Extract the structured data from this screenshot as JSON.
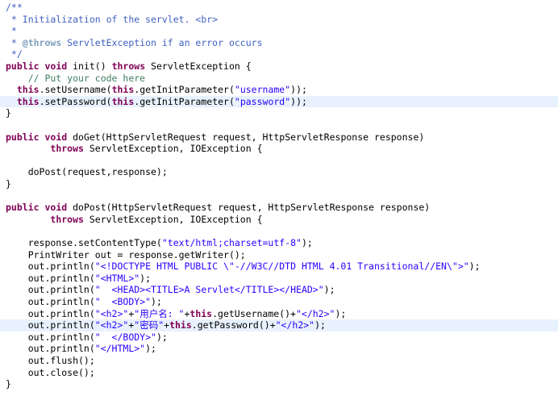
{
  "colors": {
    "comment": "#3f5fbf",
    "keyword": "#7f0055",
    "string": "#2a00ff",
    "line_comment": "#3f7f5f",
    "highlight": "#e8f2fe"
  },
  "code_lines": [
    {
      "hl": false,
      "tokens": [
        {
          "t": "/**",
          "c": "comment"
        }
      ]
    },
    {
      "hl": false,
      "tokens": [
        {
          "t": " * Initialization of the servlet. <br>",
          "c": "comment"
        }
      ]
    },
    {
      "hl": false,
      "tokens": [
        {
          "t": " *",
          "c": "comment"
        }
      ]
    },
    {
      "hl": false,
      "tokens": [
        {
          "t": " * ",
          "c": "comment"
        },
        {
          "t": "@throws",
          "c": "javadoc-tag"
        },
        {
          "t": " ServletException if an error occurs",
          "c": "comment"
        }
      ]
    },
    {
      "hl": false,
      "tokens": [
        {
          "t": " */",
          "c": "comment"
        }
      ]
    },
    {
      "hl": false,
      "tokens": [
        {
          "t": "public",
          "c": "keyword"
        },
        {
          "t": " ",
          "c": "plain"
        },
        {
          "t": "void",
          "c": "keyword"
        },
        {
          "t": " init() ",
          "c": "plain"
        },
        {
          "t": "throws",
          "c": "keyword"
        },
        {
          "t": " ServletException {",
          "c": "plain"
        }
      ]
    },
    {
      "hl": false,
      "tokens": [
        {
          "t": "    // Put your code here",
          "c": "line-comment"
        }
      ]
    },
    {
      "hl": false,
      "tokens": [
        {
          "t": "  ",
          "c": "plain"
        },
        {
          "t": "this",
          "c": "keyword"
        },
        {
          "t": ".setUsername(",
          "c": "plain"
        },
        {
          "t": "this",
          "c": "keyword"
        },
        {
          "t": ".getInitParameter(",
          "c": "plain"
        },
        {
          "t": "\"username\"",
          "c": "string"
        },
        {
          "t": "));",
          "c": "plain"
        }
      ]
    },
    {
      "hl": true,
      "tokens": [
        {
          "t": "  ",
          "c": "plain"
        },
        {
          "t": "this",
          "c": "keyword"
        },
        {
          "t": ".setPassword(",
          "c": "plain"
        },
        {
          "t": "this",
          "c": "keyword"
        },
        {
          "t": ".getInitParameter(",
          "c": "plain"
        },
        {
          "t": "\"password\"",
          "c": "string"
        },
        {
          "t": "));",
          "c": "plain"
        }
      ]
    },
    {
      "hl": false,
      "tokens": [
        {
          "t": "}",
          "c": "plain"
        }
      ]
    },
    {
      "hl": false,
      "tokens": []
    },
    {
      "hl": false,
      "tokens": [
        {
          "t": "public",
          "c": "keyword"
        },
        {
          "t": " ",
          "c": "plain"
        },
        {
          "t": "void",
          "c": "keyword"
        },
        {
          "t": " doGet(HttpServletRequest request, HttpServletResponse response)",
          "c": "plain"
        }
      ]
    },
    {
      "hl": false,
      "tokens": [
        {
          "t": "        ",
          "c": "plain"
        },
        {
          "t": "throws",
          "c": "keyword"
        },
        {
          "t": " ServletException, IOException {",
          "c": "plain"
        }
      ]
    },
    {
      "hl": false,
      "tokens": []
    },
    {
      "hl": false,
      "tokens": [
        {
          "t": "    doPost(request,response);",
          "c": "plain"
        }
      ]
    },
    {
      "hl": false,
      "tokens": [
        {
          "t": "}",
          "c": "plain"
        }
      ]
    },
    {
      "hl": false,
      "tokens": []
    },
    {
      "hl": false,
      "tokens": [
        {
          "t": "public",
          "c": "keyword"
        },
        {
          "t": " ",
          "c": "plain"
        },
        {
          "t": "void",
          "c": "keyword"
        },
        {
          "t": " doPost(HttpServletRequest request, HttpServletResponse response)",
          "c": "plain"
        }
      ]
    },
    {
      "hl": false,
      "tokens": [
        {
          "t": "        ",
          "c": "plain"
        },
        {
          "t": "throws",
          "c": "keyword"
        },
        {
          "t": " ServletException, IOException {",
          "c": "plain"
        }
      ]
    },
    {
      "hl": false,
      "tokens": []
    },
    {
      "hl": false,
      "tokens": [
        {
          "t": "    response.setContentType(",
          "c": "plain"
        },
        {
          "t": "\"text/html;charset=utf-8\"",
          "c": "string"
        },
        {
          "t": ");",
          "c": "plain"
        }
      ]
    },
    {
      "hl": false,
      "tokens": [
        {
          "t": "    PrintWriter out = response.getWriter();",
          "c": "plain"
        }
      ]
    },
    {
      "hl": false,
      "tokens": [
        {
          "t": "    out.println(",
          "c": "plain"
        },
        {
          "t": "\"<!DOCTYPE HTML PUBLIC \\\"-//W3C//DTD HTML 4.01 Transitional//EN\\\">\"",
          "c": "string"
        },
        {
          "t": ");",
          "c": "plain"
        }
      ]
    },
    {
      "hl": false,
      "tokens": [
        {
          "t": "    out.println(",
          "c": "plain"
        },
        {
          "t": "\"<HTML>\"",
          "c": "string"
        },
        {
          "t": ");",
          "c": "plain"
        }
      ]
    },
    {
      "hl": false,
      "tokens": [
        {
          "t": "    out.println(",
          "c": "plain"
        },
        {
          "t": "\"  <HEAD><TITLE>A Servlet</TITLE></HEAD>\"",
          "c": "string"
        },
        {
          "t": ");",
          "c": "plain"
        }
      ]
    },
    {
      "hl": false,
      "tokens": [
        {
          "t": "    out.println(",
          "c": "plain"
        },
        {
          "t": "\"  <BODY>\"",
          "c": "string"
        },
        {
          "t": ");",
          "c": "plain"
        }
      ]
    },
    {
      "hl": false,
      "tokens": [
        {
          "t": "    out.println(",
          "c": "plain"
        },
        {
          "t": "\"<h2>\"",
          "c": "string"
        },
        {
          "t": "+",
          "c": "plain"
        },
        {
          "t": "\"用户名: \"",
          "c": "string"
        },
        {
          "t": "+",
          "c": "plain"
        },
        {
          "t": "this",
          "c": "keyword"
        },
        {
          "t": ".getUsername()+",
          "c": "plain"
        },
        {
          "t": "\"</h2>\"",
          "c": "string"
        },
        {
          "t": ");",
          "c": "plain"
        }
      ]
    },
    {
      "hl": true,
      "tokens": [
        {
          "t": "    out.println(",
          "c": "plain"
        },
        {
          "t": "\"<h2>\"",
          "c": "string"
        },
        {
          "t": "+",
          "c": "plain"
        },
        {
          "t": "\"密码\"",
          "c": "string"
        },
        {
          "t": "+",
          "c": "plain"
        },
        {
          "t": "this",
          "c": "keyword"
        },
        {
          "t": ".getPassword()+",
          "c": "plain"
        },
        {
          "t": "\"</h2>\"",
          "c": "string"
        },
        {
          "t": ");",
          "c": "plain"
        }
      ]
    },
    {
      "hl": false,
      "tokens": [
        {
          "t": "    out.println(",
          "c": "plain"
        },
        {
          "t": "\"  </BODY>\"",
          "c": "string"
        },
        {
          "t": ");",
          "c": "plain"
        }
      ]
    },
    {
      "hl": false,
      "tokens": [
        {
          "t": "    out.println(",
          "c": "plain"
        },
        {
          "t": "\"</HTML>\"",
          "c": "string"
        },
        {
          "t": ");",
          "c": "plain"
        }
      ]
    },
    {
      "hl": false,
      "tokens": [
        {
          "t": "    out.flush();",
          "c": "plain"
        }
      ]
    },
    {
      "hl": false,
      "tokens": [
        {
          "t": "    out.close();",
          "c": "plain"
        }
      ]
    },
    {
      "hl": false,
      "tokens": [
        {
          "t": "}",
          "c": "plain"
        }
      ]
    }
  ]
}
